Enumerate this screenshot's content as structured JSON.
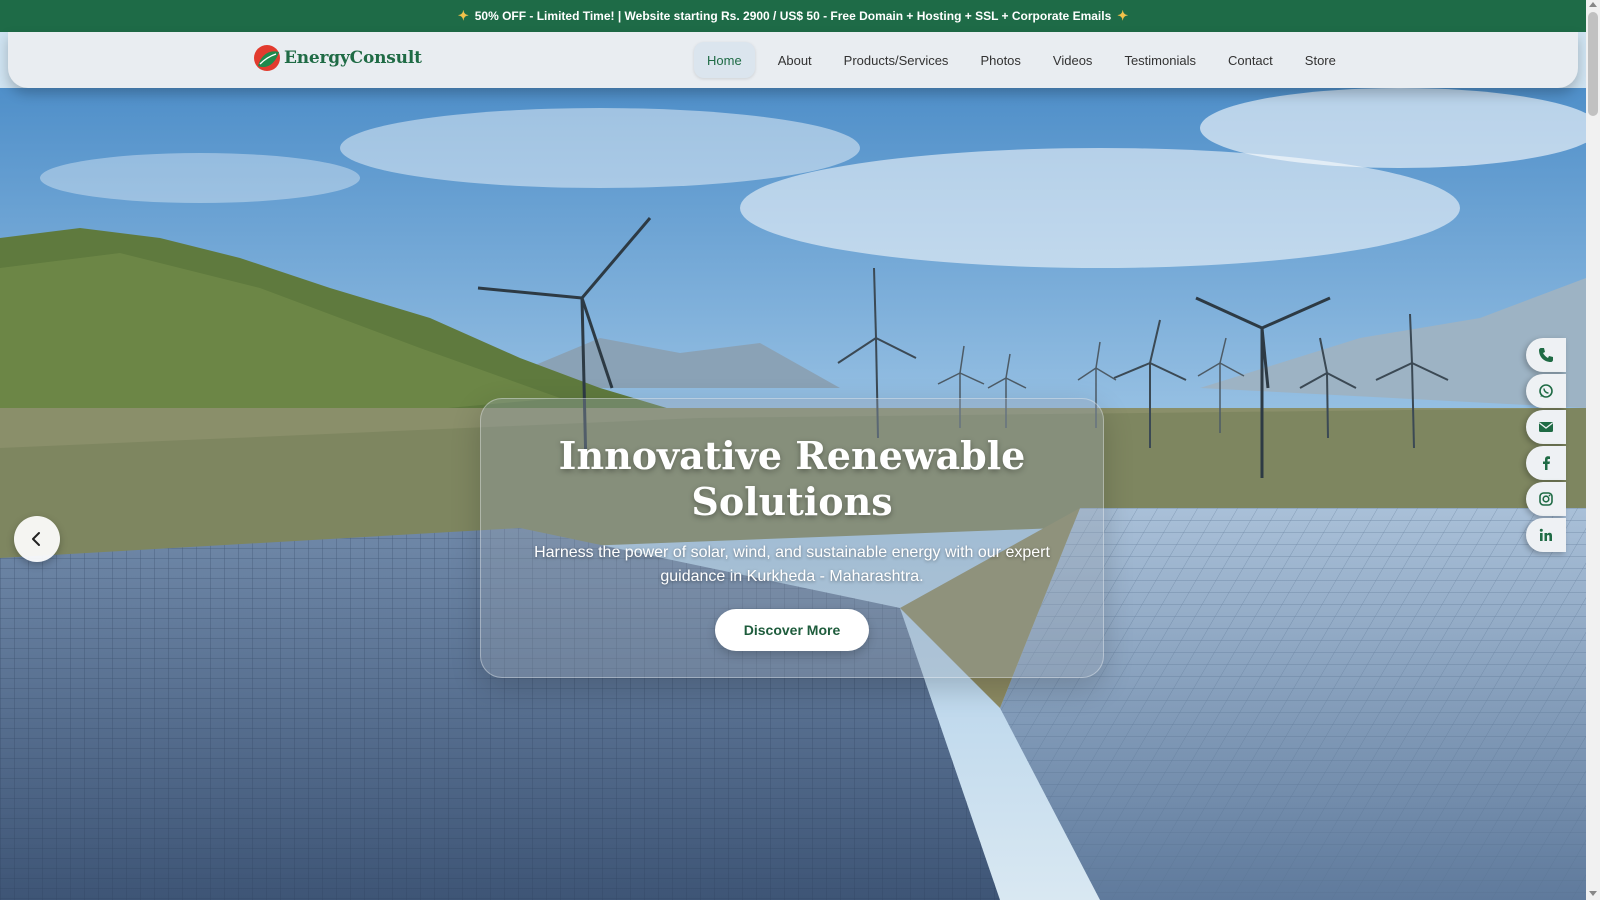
{
  "promo": {
    "icon": "party-popper-icon",
    "text": "50% OFF - Limited Time! | Website starting Rs. 2900 / US$ 50 - Free Domain + Hosting + SSL + Corporate Emails"
  },
  "brand": {
    "name": "EnergyConsult",
    "color": "#1f6b45",
    "accent_red": "#e23b2e"
  },
  "nav": {
    "items": [
      {
        "label": "Home",
        "active": true
      },
      {
        "label": "About"
      },
      {
        "label": "Products/Services"
      },
      {
        "label": "Photos"
      },
      {
        "label": "Videos"
      },
      {
        "label": "Testimonials"
      },
      {
        "label": "Contact"
      },
      {
        "label": "Store"
      }
    ]
  },
  "hero": {
    "title": "Innovative Renewable Solutions",
    "subtitle": "Harness the power of solar, wind, and sustainable energy with our expert guidance in Kurkheda - Maharashtra.",
    "cta_label": "Discover More",
    "background": "wind-turbines-solar-farm-image"
  },
  "social": [
    {
      "icon": "phone-icon"
    },
    {
      "icon": "whatsapp-icon"
    },
    {
      "icon": "envelope-icon"
    },
    {
      "icon": "facebook-icon"
    },
    {
      "icon": "instagram-icon"
    },
    {
      "icon": "linkedin-icon"
    }
  ],
  "colors": {
    "promo_bg": "#1e6b47",
    "header_bg": "#e9edf1",
    "cta_text": "#1e5c3c"
  }
}
